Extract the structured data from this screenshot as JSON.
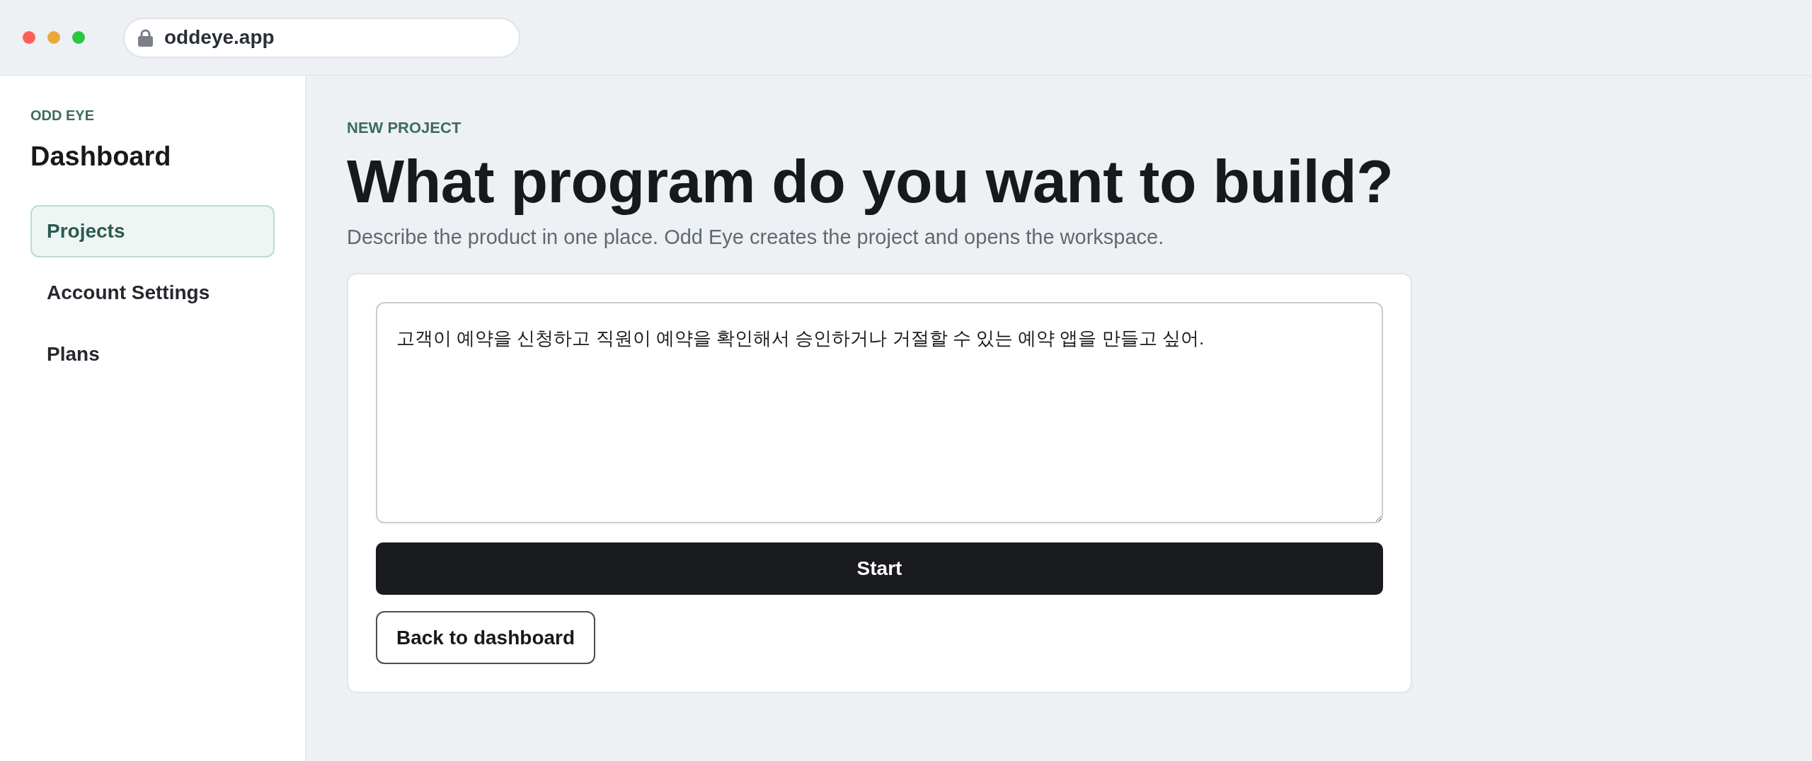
{
  "browser": {
    "address": "oddeye.app"
  },
  "sidebar": {
    "brand": "ODD EYE",
    "title": "Dashboard",
    "items": [
      {
        "label": "Projects",
        "selected": true
      },
      {
        "label": "Account Settings",
        "selected": false
      },
      {
        "label": "Plans",
        "selected": false
      }
    ]
  },
  "main": {
    "eyebrow": "NEW PROJECT",
    "heading": "What program do you want to build?",
    "subtitle": "Describe the product in one place. Odd Eye creates the project and opens the workspace.",
    "form": {
      "description": {
        "value": "고객이 예약을 신청하고 직원이 예약을 확인해서 승인하거나 거절할 수 있는 예약 앱을 만들고 싶어."
      },
      "buttons": [
        {
          "label": "Start",
          "kind": "primary"
        },
        {
          "label": "Back to dashboard",
          "kind": "secondary"
        }
      ]
    }
  }
}
